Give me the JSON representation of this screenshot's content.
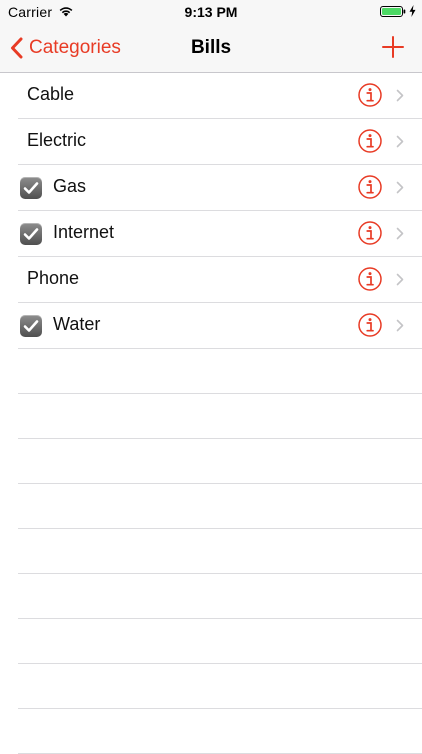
{
  "status_bar": {
    "carrier": "Carrier",
    "time": "9:13 PM"
  },
  "nav": {
    "back_label": "Categories",
    "title": "Bills",
    "add_icon": "plus-icon"
  },
  "colors": {
    "accent": "#e83b25",
    "battery": "#4cd964"
  },
  "bills": [
    {
      "label": "Cable",
      "checked": false
    },
    {
      "label": "Electric",
      "checked": false
    },
    {
      "label": "Gas",
      "checked": true
    },
    {
      "label": "Internet",
      "checked": true
    },
    {
      "label": "Phone",
      "checked": false
    },
    {
      "label": "Water",
      "checked": true
    }
  ]
}
